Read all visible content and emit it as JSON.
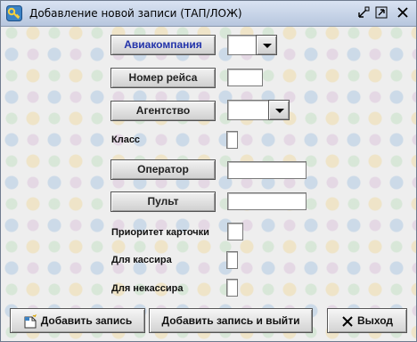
{
  "window": {
    "title": "Добавление новой записи (ТАП/ЛОЖ)"
  },
  "form": {
    "airline_button": "Авиакомпания",
    "flight_number_button": "Номер рейса",
    "agency_button": "Агентство",
    "class_label": "Класс",
    "operator_button": "Оператор",
    "desk_button": "Пульт",
    "card_priority_label": "Приоритет карточки",
    "for_cashier_label": "Для кассира",
    "for_non_cashier_label": "Для некассира",
    "airline_value": "",
    "flight_number_value": "",
    "agency_value": "",
    "class_value": "",
    "operator_value": "",
    "desk_value": "",
    "card_priority_value": "",
    "for_cashier_value": "",
    "for_non_cashier_value": ""
  },
  "footer": {
    "add_record": "Добавить запись",
    "add_record_and_exit": "Добавить запись и выйти",
    "exit": "Выход"
  },
  "icons": {
    "app": "key-icon",
    "minimize": "minimize-icon",
    "maximize": "maximize-icon",
    "close": "close-icon",
    "add_record": "new-document-icon",
    "exit": "x-icon"
  },
  "colors": {
    "accent_label": "#2233aa",
    "titlebar": "#c5d3e8"
  }
}
